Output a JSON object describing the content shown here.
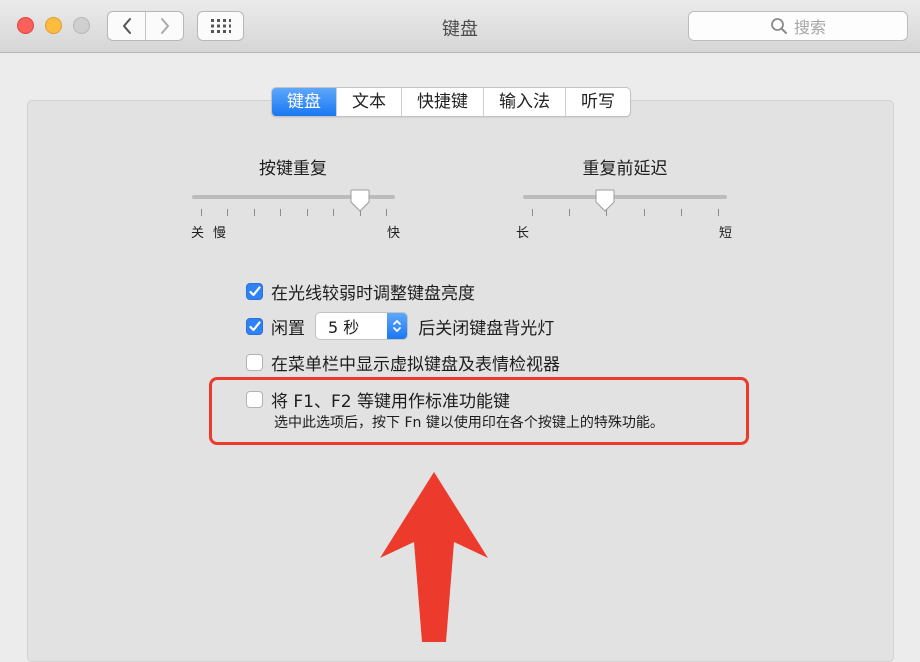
{
  "window": {
    "title": "键盘",
    "search_placeholder": "搜索"
  },
  "tabs": [
    {
      "label": "键盘",
      "active": true
    },
    {
      "label": "文本",
      "active": false
    },
    {
      "label": "快捷键",
      "active": false
    },
    {
      "label": "输入法",
      "active": false
    },
    {
      "label": "听写",
      "active": false
    }
  ],
  "sliders": {
    "key_repeat": {
      "label": "按键重复",
      "left_labels": [
        "关",
        "慢"
      ],
      "right_label": "快",
      "value": 0.83
    },
    "delay": {
      "label": "重复前延迟",
      "left_label": "长",
      "right_label": "短",
      "value": 0.4
    }
  },
  "options": {
    "brightness": {
      "label": "在光线较弱时调整键盘亮度",
      "checked": true
    },
    "backlight": {
      "prefix": "闲置",
      "popup_value": "5 秒",
      "suffix": "后关闭键盘背光灯",
      "checked": true
    },
    "viewer": {
      "label": "在菜单栏中显示虚拟键盘及表情检视器",
      "checked": false
    },
    "fn_keys": {
      "label": "将 F1、F2 等键用作标准功能键",
      "checked": false,
      "description": "选中此选项后，按下 Fn 键以使用印在各个按键上的特殊功能。"
    }
  },
  "colors": {
    "accent": "#1a78f2",
    "annotation": "#ec3b2c"
  }
}
